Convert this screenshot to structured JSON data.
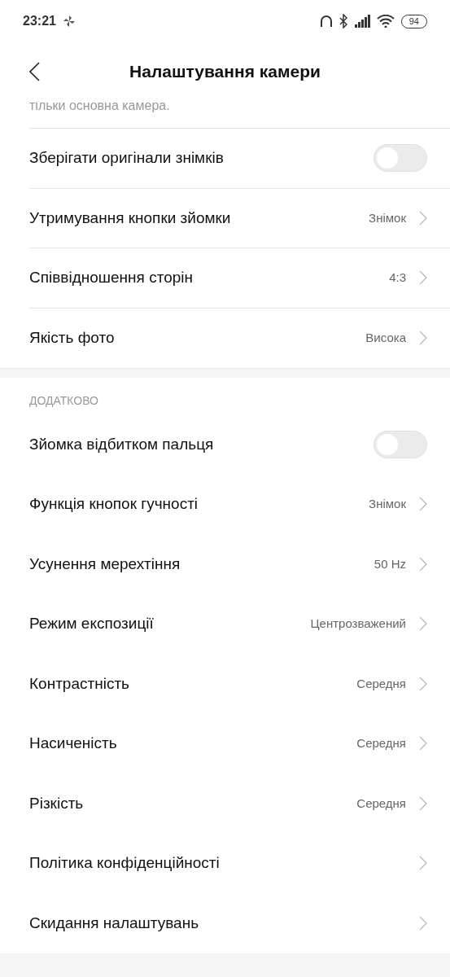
{
  "status_bar": {
    "time": "23:21",
    "battery": "94"
  },
  "header": {
    "title": "Налаштування камери"
  },
  "cut_note": "тільки основна камера.",
  "groups": [
    {
      "items": [
        {
          "kind": "toggle",
          "label": "Зберігати оригінали знімків",
          "on": false
        },
        {
          "kind": "value",
          "label": "Утримування кнопки зйомки",
          "value": "Знімок"
        },
        {
          "kind": "value",
          "label": "Співвідношення сторін",
          "value": "4:3"
        },
        {
          "kind": "value",
          "label": "Якість фото",
          "value": "Висока"
        }
      ]
    },
    {
      "heading": "ДОДАТКОВО",
      "items": [
        {
          "kind": "toggle",
          "label": "Зйомка відбитком пальця",
          "on": false
        },
        {
          "kind": "value",
          "label": "Функція кнопок гучності",
          "value": "Знімок"
        },
        {
          "kind": "value",
          "label": "Усунення мерехтіння",
          "value": "50 Hz"
        },
        {
          "kind": "value",
          "label": "Режим експозиції",
          "value": "Центрозважений"
        },
        {
          "kind": "value",
          "label": "Контрастність",
          "value": "Середня"
        },
        {
          "kind": "value",
          "label": "Насиченість",
          "value": "Середня"
        },
        {
          "kind": "value",
          "label": "Різкість",
          "value": "Середня"
        },
        {
          "kind": "link",
          "label": "Політика конфіденційності"
        },
        {
          "kind": "link",
          "label": "Скидання налаштувань"
        }
      ]
    }
  ]
}
